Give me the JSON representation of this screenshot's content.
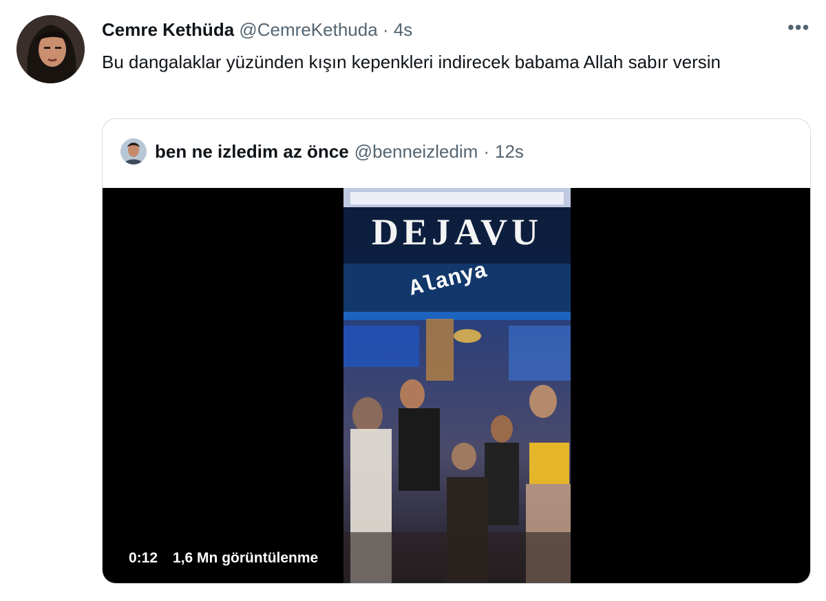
{
  "tweet": {
    "author_name": "Cemre Kethüda",
    "handle": "@CemreKethuda",
    "separator": "·",
    "time": "4s",
    "more_icon": "more-horizontal-icon",
    "text": "Bu dangalaklar yüzünden kışın kepenkleri indirecek babama Allah sabır versin"
  },
  "quoted_tweet": {
    "author_name": "ben ne izledim az önce",
    "handle": "@benneizledim",
    "separator": "·",
    "time": "12s",
    "video": {
      "sign_text": "DEJAVU",
      "location_sticker": "Alanya",
      "duration": "0:12",
      "views": "1,6 Mn görüntülenme"
    }
  }
}
